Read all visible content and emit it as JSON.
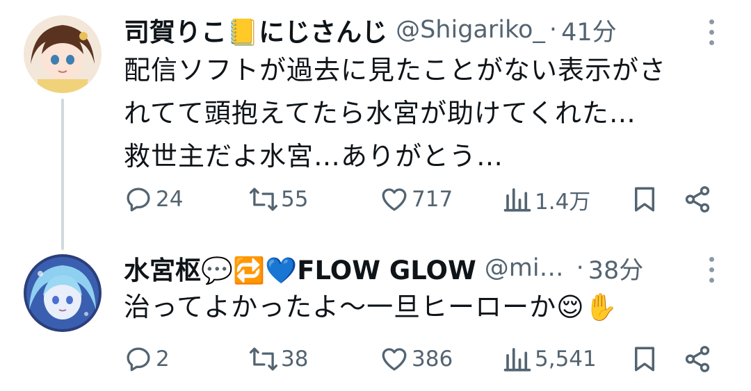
{
  "tweets": [
    {
      "name": "司賀りこ📒にじさんじ",
      "handle": "@Shigariko_",
      "separator": "·",
      "time": "41分",
      "text_lines": [
        "配信ソフトが過去に見たことがない表示がさ",
        "れてて頭抱えてたら水宮が助けてくれた…",
        "救世主だよ水宮…ありがとう…"
      ],
      "replies": "24",
      "reposts": "55",
      "likes": "717",
      "views": "1.4万"
    },
    {
      "name": "水宮枢💬🔁💙FLOW GLOW",
      "handle": "@mi…",
      "separator": "·",
      "time": "38分",
      "text_lines": [
        "治ってよかったよ〜一旦ヒーローか😌✋"
      ],
      "replies": "2",
      "reposts": "38",
      "likes": "386",
      "views": "5,541"
    }
  ],
  "icons": {
    "reply": "reply-icon",
    "repost": "repost-icon",
    "like": "heart-icon",
    "views": "views-icon",
    "bookmark": "bookmark-icon",
    "share": "share-icon",
    "more": "more-icon"
  },
  "colors": {
    "text": "#0f1419",
    "secondary": "#536471",
    "thread_line": "#cfd9de"
  }
}
